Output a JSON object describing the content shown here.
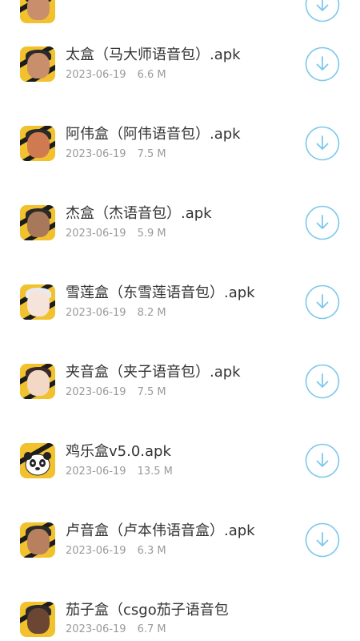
{
  "accent_color": "#7cc8ec",
  "items": [
    {
      "title": "",
      "date": "",
      "size": "",
      "icon": "partial-avatar-icon",
      "action": "download-icon"
    },
    {
      "title": "太盒（马大师语音包）.apk",
      "date": "2023-06-19",
      "size": "6.6 M",
      "icon": "avatar-icon",
      "action": "download-icon"
    },
    {
      "title": "阿伟盒（阿伟语音包）.apk",
      "date": "2023-06-19",
      "size": "7.5 M",
      "icon": "avatar-icon",
      "action": "download-icon"
    },
    {
      "title": "杰盒（杰语音包）.apk",
      "date": "2023-06-19",
      "size": "5.9 M",
      "icon": "avatar-icon",
      "action": "download-icon"
    },
    {
      "title": "雪莲盒（东雪莲语音包）.apk",
      "date": "2023-06-19",
      "size": "8.2 M",
      "icon": "avatar-icon",
      "action": "download-icon"
    },
    {
      "title": "夹音盒（夹子语音包）.apk",
      "date": "2023-06-19",
      "size": "7.5 M",
      "icon": "avatar-icon",
      "action": "download-icon"
    },
    {
      "title": "鸡乐盒v5.0.apk",
      "date": "2023-06-19",
      "size": "13.5 M",
      "icon": "panda-avatar-icon",
      "action": "download-icon"
    },
    {
      "title": "卢音盒（卢本伟语音盒）.apk",
      "date": "2023-06-19",
      "size": "6.3 M",
      "icon": "avatar-icon",
      "action": "download-icon"
    },
    {
      "title": "茄子盒（csgo茄子语音包",
      "date": "2023-06-19",
      "size": "6.7 M",
      "icon": "avatar-icon",
      "action": "download-icon"
    }
  ]
}
